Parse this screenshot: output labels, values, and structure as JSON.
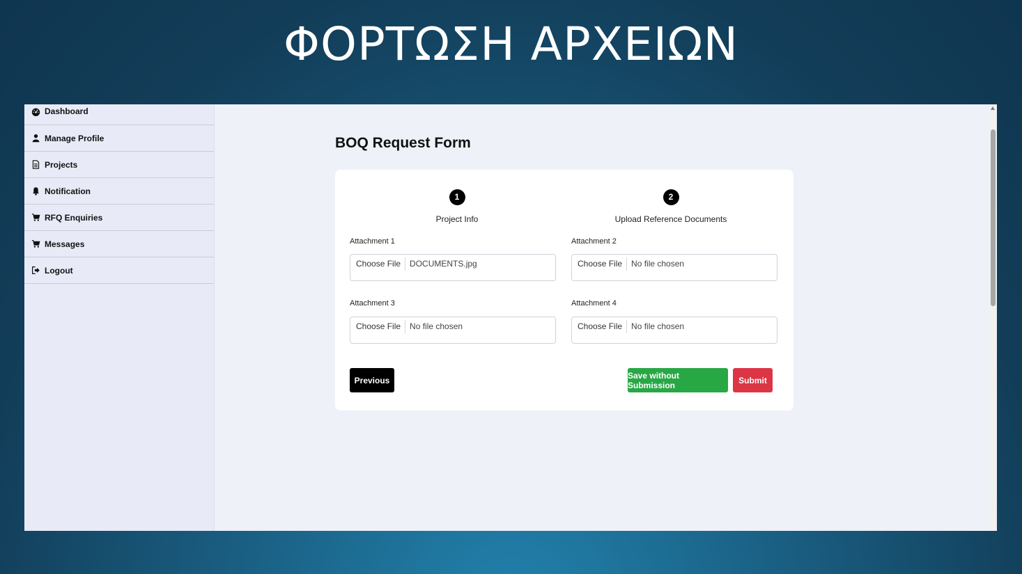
{
  "slide": {
    "title": "ΦΟΡΤΩΣΗ ΑΡΧΕΙΩΝ"
  },
  "sidebar": {
    "items": [
      {
        "label": "Dashboard",
        "icon": "dashboard-icon"
      },
      {
        "label": "Manage Profile",
        "icon": "user-icon"
      },
      {
        "label": "Projects",
        "icon": "document-icon"
      },
      {
        "label": "Notification",
        "icon": "bell-icon"
      },
      {
        "label": "RFQ Enquiries",
        "icon": "cart-icon"
      },
      {
        "label": "Messages",
        "icon": "cart-icon"
      },
      {
        "label": "Logout",
        "icon": "logout-icon"
      }
    ]
  },
  "form": {
    "title": "BOQ Request Form",
    "steps": [
      {
        "number": "1",
        "label": "Project Info"
      },
      {
        "number": "2",
        "label": "Upload Reference Documents"
      }
    ],
    "attachments": [
      {
        "label": "Attachment 1",
        "button": "Choose File",
        "file": "DOCUMENTS.jpg"
      },
      {
        "label": "Attachment 2",
        "button": "Choose File",
        "file": "No file chosen"
      },
      {
        "label": "Attachment 3",
        "button": "Choose File",
        "file": "No file chosen"
      },
      {
        "label": "Attachment 4",
        "button": "Choose File",
        "file": "No file chosen"
      }
    ],
    "buttons": {
      "previous": "Previous",
      "save": "Save without Submission",
      "submit": "Submit"
    }
  },
  "colors": {
    "previous": "#000000",
    "save": "#28a745",
    "submit": "#dc3545"
  }
}
